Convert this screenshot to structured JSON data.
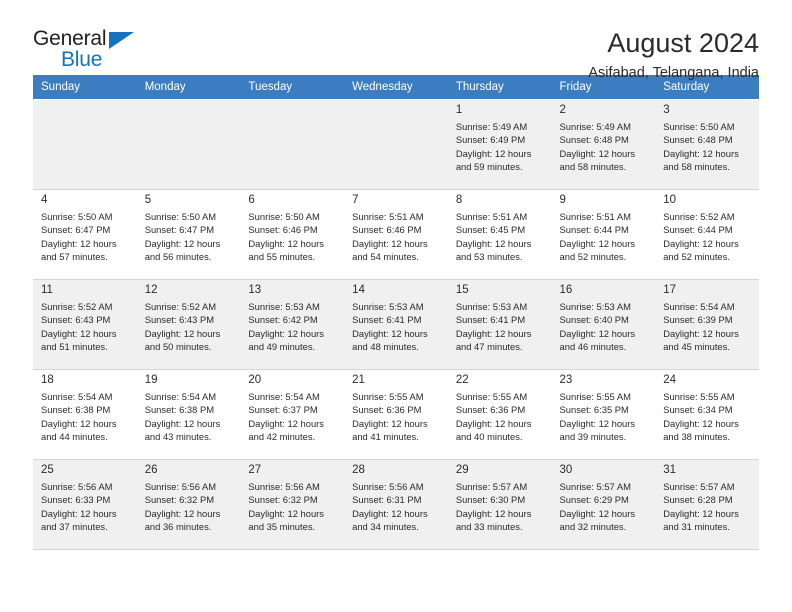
{
  "brand": {
    "word1": "General",
    "word2": "Blue",
    "triangle_color": "#1574bd"
  },
  "header": {
    "title": "August 2024",
    "subtitle": "Asifabad, Telangana, India"
  },
  "calendar": {
    "header_bg": "#3b7dc0",
    "weekdays": [
      "Sunday",
      "Monday",
      "Tuesday",
      "Wednesday",
      "Thursday",
      "Friday",
      "Saturday"
    ],
    "weeks": [
      [
        {
          "day": "",
          "detail": "",
          "empty": true
        },
        {
          "day": "",
          "detail": "",
          "empty": true
        },
        {
          "day": "",
          "detail": "",
          "empty": true
        },
        {
          "day": "",
          "detail": "",
          "empty": true
        },
        {
          "day": "1",
          "detail": "Sunrise: 5:49 AM\nSunset: 6:49 PM\nDaylight: 12 hours\nand 59 minutes."
        },
        {
          "day": "2",
          "detail": "Sunrise: 5:49 AM\nSunset: 6:48 PM\nDaylight: 12 hours\nand 58 minutes."
        },
        {
          "day": "3",
          "detail": "Sunrise: 5:50 AM\nSunset: 6:48 PM\nDaylight: 12 hours\nand 58 minutes."
        }
      ],
      [
        {
          "day": "4",
          "detail": "Sunrise: 5:50 AM\nSunset: 6:47 PM\nDaylight: 12 hours\nand 57 minutes."
        },
        {
          "day": "5",
          "detail": "Sunrise: 5:50 AM\nSunset: 6:47 PM\nDaylight: 12 hours\nand 56 minutes."
        },
        {
          "day": "6",
          "detail": "Sunrise: 5:50 AM\nSunset: 6:46 PM\nDaylight: 12 hours\nand 55 minutes."
        },
        {
          "day": "7",
          "detail": "Sunrise: 5:51 AM\nSunset: 6:46 PM\nDaylight: 12 hours\nand 54 minutes."
        },
        {
          "day": "8",
          "detail": "Sunrise: 5:51 AM\nSunset: 6:45 PM\nDaylight: 12 hours\nand 53 minutes."
        },
        {
          "day": "9",
          "detail": "Sunrise: 5:51 AM\nSunset: 6:44 PM\nDaylight: 12 hours\nand 52 minutes."
        },
        {
          "day": "10",
          "detail": "Sunrise: 5:52 AM\nSunset: 6:44 PM\nDaylight: 12 hours\nand 52 minutes."
        }
      ],
      [
        {
          "day": "11",
          "detail": "Sunrise: 5:52 AM\nSunset: 6:43 PM\nDaylight: 12 hours\nand 51 minutes."
        },
        {
          "day": "12",
          "detail": "Sunrise: 5:52 AM\nSunset: 6:43 PM\nDaylight: 12 hours\nand 50 minutes."
        },
        {
          "day": "13",
          "detail": "Sunrise: 5:53 AM\nSunset: 6:42 PM\nDaylight: 12 hours\nand 49 minutes."
        },
        {
          "day": "14",
          "detail": "Sunrise: 5:53 AM\nSunset: 6:41 PM\nDaylight: 12 hours\nand 48 minutes."
        },
        {
          "day": "15",
          "detail": "Sunrise: 5:53 AM\nSunset: 6:41 PM\nDaylight: 12 hours\nand 47 minutes."
        },
        {
          "day": "16",
          "detail": "Sunrise: 5:53 AM\nSunset: 6:40 PM\nDaylight: 12 hours\nand 46 minutes."
        },
        {
          "day": "17",
          "detail": "Sunrise: 5:54 AM\nSunset: 6:39 PM\nDaylight: 12 hours\nand 45 minutes."
        }
      ],
      [
        {
          "day": "18",
          "detail": "Sunrise: 5:54 AM\nSunset: 6:38 PM\nDaylight: 12 hours\nand 44 minutes."
        },
        {
          "day": "19",
          "detail": "Sunrise: 5:54 AM\nSunset: 6:38 PM\nDaylight: 12 hours\nand 43 minutes."
        },
        {
          "day": "20",
          "detail": "Sunrise: 5:54 AM\nSunset: 6:37 PM\nDaylight: 12 hours\nand 42 minutes."
        },
        {
          "day": "21",
          "detail": "Sunrise: 5:55 AM\nSunset: 6:36 PM\nDaylight: 12 hours\nand 41 minutes."
        },
        {
          "day": "22",
          "detail": "Sunrise: 5:55 AM\nSunset: 6:36 PM\nDaylight: 12 hours\nand 40 minutes."
        },
        {
          "day": "23",
          "detail": "Sunrise: 5:55 AM\nSunset: 6:35 PM\nDaylight: 12 hours\nand 39 minutes."
        },
        {
          "day": "24",
          "detail": "Sunrise: 5:55 AM\nSunset: 6:34 PM\nDaylight: 12 hours\nand 38 minutes."
        }
      ],
      [
        {
          "day": "25",
          "detail": "Sunrise: 5:56 AM\nSunset: 6:33 PM\nDaylight: 12 hours\nand 37 minutes."
        },
        {
          "day": "26",
          "detail": "Sunrise: 5:56 AM\nSunset: 6:32 PM\nDaylight: 12 hours\nand 36 minutes."
        },
        {
          "day": "27",
          "detail": "Sunrise: 5:56 AM\nSunset: 6:32 PM\nDaylight: 12 hours\nand 35 minutes."
        },
        {
          "day": "28",
          "detail": "Sunrise: 5:56 AM\nSunset: 6:31 PM\nDaylight: 12 hours\nand 34 minutes."
        },
        {
          "day": "29",
          "detail": "Sunrise: 5:57 AM\nSunset: 6:30 PM\nDaylight: 12 hours\nand 33 minutes."
        },
        {
          "day": "30",
          "detail": "Sunrise: 5:57 AM\nSunset: 6:29 PM\nDaylight: 12 hours\nand 32 minutes."
        },
        {
          "day": "31",
          "detail": "Sunrise: 5:57 AM\nSunset: 6:28 PM\nDaylight: 12 hours\nand 31 minutes."
        }
      ]
    ]
  }
}
